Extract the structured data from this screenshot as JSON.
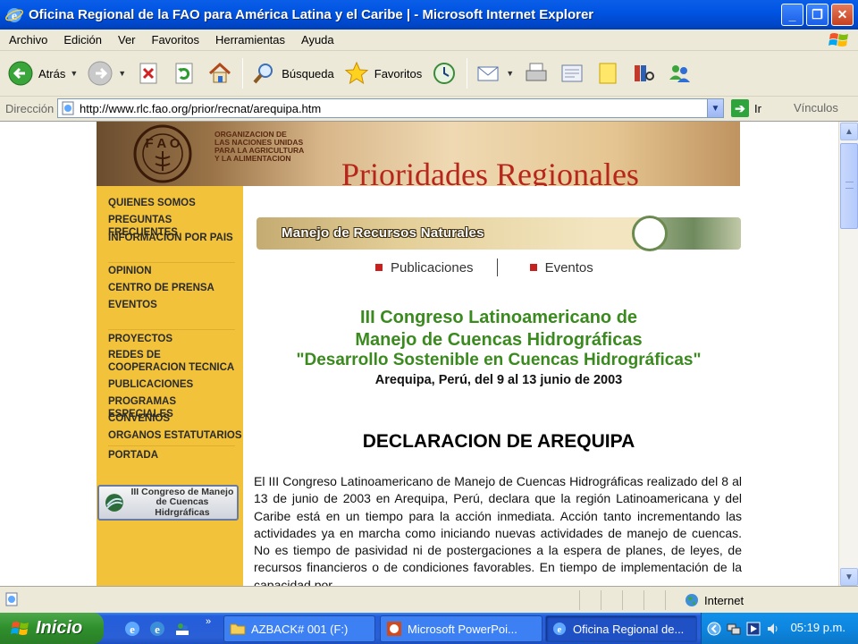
{
  "window": {
    "title": "Oficina Regional de la FAO para América Latina y el Caribe | - Microsoft Internet Explorer",
    "minimize": "_",
    "maximize": "❐",
    "close": "✕"
  },
  "menu": [
    "Archivo",
    "Edición",
    "Ver",
    "Favoritos",
    "Herramientas",
    "Ayuda"
  ],
  "toolbar": {
    "back_label": "Atrás",
    "search_label": "Búsqueda",
    "favorites_label": "Favoritos"
  },
  "address": {
    "label": "Dirección",
    "url": "http://www.rlc.fao.org/prior/recnat/arequipa.htm",
    "go_label": "Ir",
    "links_label": "Vínculos"
  },
  "page": {
    "banner": {
      "org_lines": [
        "ORGANIZACION DE",
        "LAS NACIONES UNIDAS",
        "PARA LA AGRICULTURA",
        "Y LA ALIMENTACION"
      ],
      "headline": "Prioridades Regionales"
    },
    "sidebar": {
      "group1": [
        "QUIENES SOMOS",
        "PREGUNTAS FRECUENTES",
        "INFORMACION POR PAIS"
      ],
      "group2": [
        "OPINION",
        "CENTRO DE PRENSA",
        "EVENTOS"
      ],
      "group3": [
        "PROYECTOS",
        "REDES DE",
        "COOPERACION TECNICA",
        "PUBLICACIONES",
        "PROGRAMAS ESPECIALES",
        "CONVENIOS",
        "ORGANOS ESTATUTARIOS"
      ],
      "portada": "PORTADA",
      "congreso_button": [
        "III Congreso de Manejo",
        "de Cuencas Hidrgráficas"
      ]
    },
    "section_bar": "Manejo de Recursos Naturales",
    "sublinks": [
      "Publicaciones",
      "Eventos"
    ],
    "conference": {
      "line1": "III Congreso Latinoamericano de",
      "line2": "Manejo de Cuencas Hidrográficas",
      "line3": "\"Desarrollo Sostenible en Cuencas Hidrográficas\"",
      "date": "Arequipa, Perú, del 9 al 13 junio de 2003"
    },
    "declaration_title": "DECLARACION DE AREQUIPA",
    "body": "El III Congreso Latinoamericano de Manejo de Cuencas Hidrográficas realizado del 8 al 13 de junio de 2003 en Arequipa, Perú, declara que la región Latinoamericana y del Caribe está en un tiempo para la acción inmediata. Acción tanto incrementando las actividades ya en marcha como iniciando nuevas actividades de manejo de cuencas. No es tiempo de pasividad ni de postergaciones a la espera de planes, de leyes, de recursos financieros o de condiciones favorables. En tiempo de implementación de la capacidad por"
  },
  "status": {
    "zone": "Internet"
  },
  "taskbar": {
    "start": "Inicio",
    "tasks": [
      "AZBACK# 001 (F:)",
      "Microsoft PowerPoi...",
      "Oficina Regional de..."
    ],
    "clock": "05:19 p.m."
  },
  "colors": {
    "title_bar": "#0054e3",
    "sidebar": "#f2c23a",
    "conference_green": "#3b8a1f",
    "headline_red": "#b7261b"
  }
}
